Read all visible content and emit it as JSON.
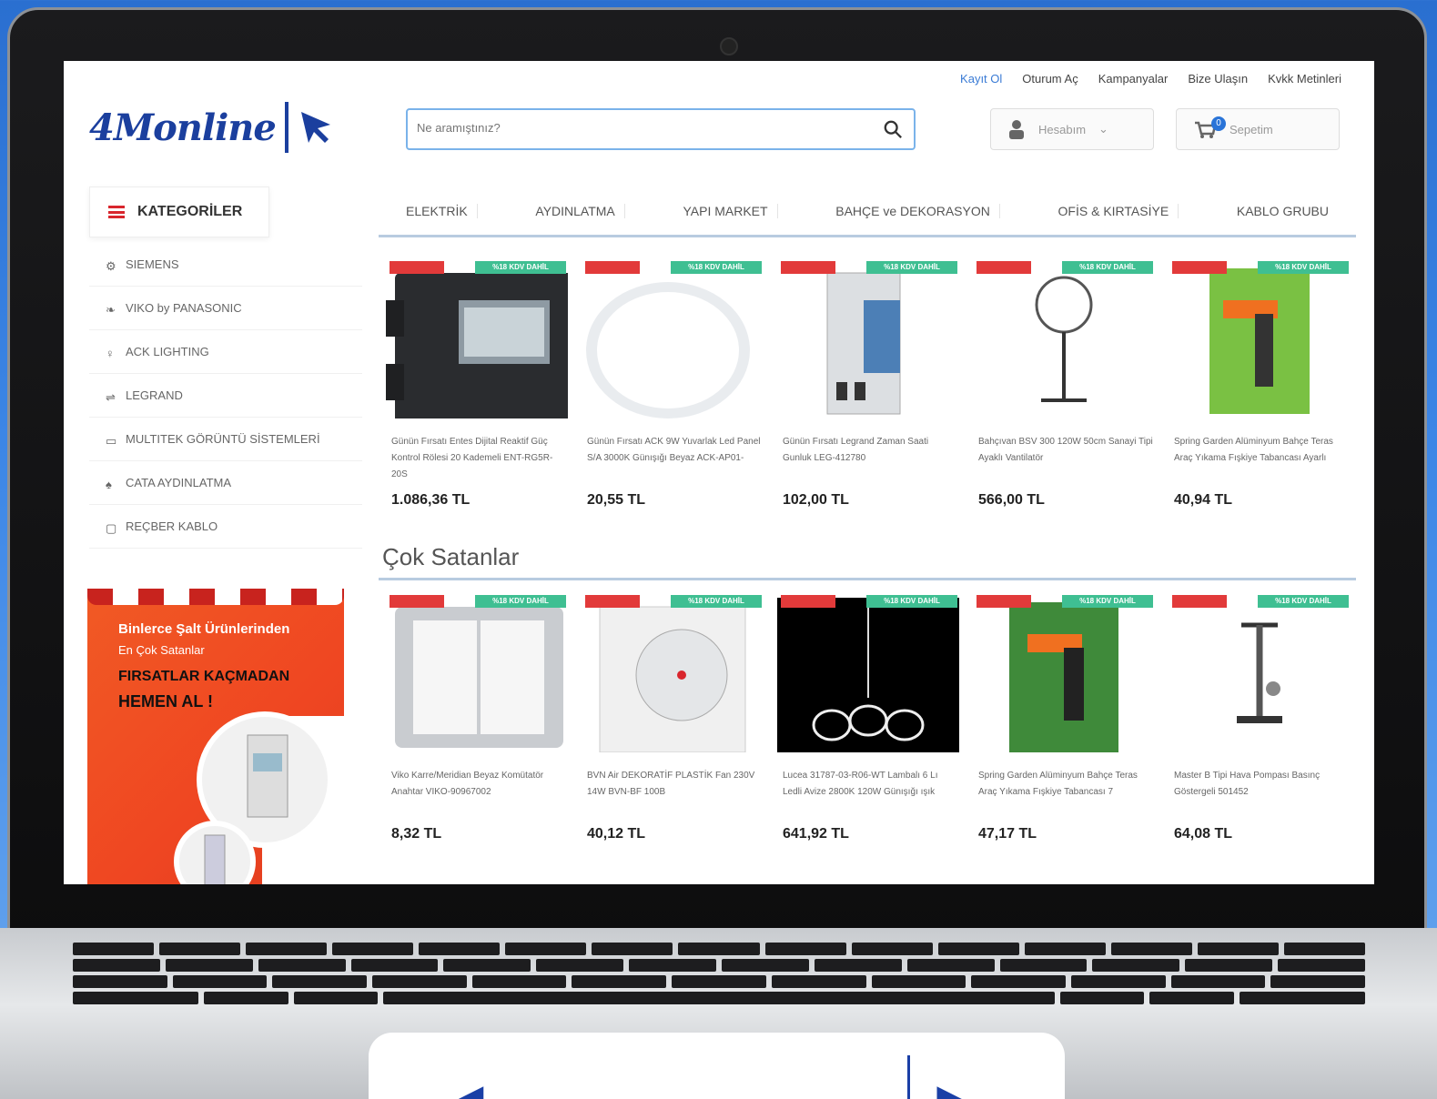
{
  "top_links": [
    "Kayıt Ol",
    "Oturum Aç",
    "Kampanyalar",
    "Bize Ulaşın",
    "Kvkk Metinleri"
  ],
  "logo": "4Monline",
  "search": {
    "placeholder": "Ne aramıştınız?"
  },
  "account": {
    "label": "Hesabım"
  },
  "cart": {
    "label": "Sepetim",
    "count": "0"
  },
  "categories_label": "KATEGORİLER",
  "nav": [
    "ELEKTRİK",
    "AYDINLATMA",
    "YAPI MARKET",
    "BAHÇE ve DEKORASYON",
    "OFİS & KIRTASİYE",
    "KABLO GRUBU"
  ],
  "brands": [
    {
      "label": "SIEMENS",
      "icon": "siemens-icon"
    },
    {
      "label": "VIKO by PANASONIC",
      "icon": "leaf-icon"
    },
    {
      "label": "ACK LIGHTING",
      "icon": "bulb-icon"
    },
    {
      "label": "LEGRAND",
      "icon": "plug-icon"
    },
    {
      "label": "MULTITEK GÖRÜNTÜ SİSTEMLERİ",
      "icon": "monitor-icon"
    },
    {
      "label": "CATA AYDINLATMA",
      "icon": "lamp-icon"
    },
    {
      "label": "REÇBER KABLO",
      "icon": "cable-icon"
    }
  ],
  "promo": {
    "line1": "Binlerce Şalt Ürünlerinden",
    "line2": "En Çok Satanlar",
    "line3": "FIRSATLAR KAÇMADAN",
    "line4": "HEMEN AL !"
  },
  "section_title": "Çok Satanlar",
  "products_top": [
    {
      "title": "Günün Fırsatı Entes Dijital Reaktif Güç Kontrol Rölesi 20 Kademeli ENT-RG5R-20S",
      "old_price": "",
      "price": "1.086,36 TL",
      "badge_red": "",
      "badge_green": "%18 KDV DAHİL",
      "img": "power-meter"
    },
    {
      "title": "Günün Fırsatı ACK 9W Yuvarlak Led Panel S/A 3000K Günışığı Beyaz ACK-AP01-",
      "old_price": "",
      "price": "20,55 TL",
      "badge_red": "",
      "badge_green": "%18 KDV DAHİL",
      "img": "led-panel"
    },
    {
      "title": "Günün Fırsatı Legrand Zaman Saati Gunluk LEG-412780",
      "old_price": "",
      "price": "102,00 TL",
      "badge_red": "",
      "badge_green": "%18 KDV DAHİL",
      "img": "timer"
    },
    {
      "title": "Bahçıvan BSV 300 120W 50cm Sanayi Tipi Ayaklı Vantilatör",
      "old_price": "",
      "price": "566,00 TL",
      "badge_red": "",
      "badge_green": "%18 KDV DAHİL",
      "img": "fan"
    },
    {
      "title": "Spring Garden Alüminyum Bahçe Teras Araç Yıkama Fışkiye Tabancası Ayarlı",
      "old_price": "",
      "price": "40,94 TL",
      "badge_red": "",
      "badge_green": "%18 KDV DAHİL",
      "img": "spray-gun"
    }
  ],
  "products_bottom": [
    {
      "title": "Viko Karre/Meridian Beyaz Komütatör Anahtar VIKO-90967002",
      "old_price": "",
      "price": "8,32 TL",
      "badge_red": "",
      "badge_green": "%18 KDV DAHİL",
      "img": "switch"
    },
    {
      "title": "BVN Air DEKORATİF PLASTİK Fan 230V 14W BVN-BF 100B",
      "old_price": "",
      "price": "40,12 TL",
      "badge_red": "",
      "badge_green": "%18 KDV DAHİL",
      "img": "exhaust-fan"
    },
    {
      "title": "Lucea 31787-03-R06-WT Lambalı 6 Lı Ledli Avize 2800K 120W Günışığı ışık",
      "old_price": "",
      "price": "641,92 TL",
      "badge_red": "",
      "badge_green": "%18 KDV DAHİL",
      "img": "chandelier"
    },
    {
      "title": "Spring Garden Alüminyum Bahçe Teras Araç Yıkama Fışkiye Tabancası 7",
      "old_price": "",
      "price": "47,17 TL",
      "badge_red": "",
      "badge_green": "%18 KDV DAHİL",
      "img": "spray-gun-2"
    },
    {
      "title": "Master B Tipi Hava Pompası Basınç Göstergeli 501452",
      "old_price": "",
      "price": "64,08 TL",
      "badge_red": "",
      "badge_green": "%18 KDV DAHİL",
      "img": "pump"
    }
  ],
  "colors": {
    "brand_blue": "#1b3f9e",
    "accent_red": "#d9262d",
    "badge_green": "#3fbf92",
    "promo_orange": "#f15a24"
  }
}
